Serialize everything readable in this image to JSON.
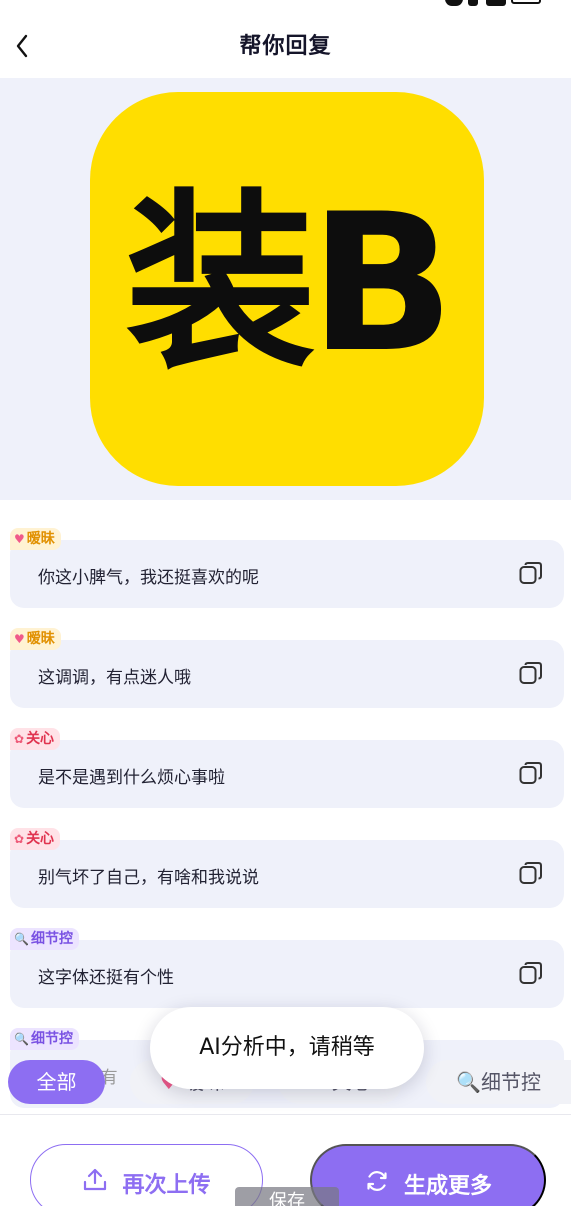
{
  "header": {
    "title": "帮你回复"
  },
  "hero": {
    "logo_text": "装B"
  },
  "replies": [
    {
      "tag_icon": "heart-icon",
      "tag": "暧昧",
      "text": "你这小脾气，我还挺喜欢的呢"
    },
    {
      "tag_icon": "heart-icon",
      "tag": "暧昧",
      "text": "这调调，有点迷人哦"
    },
    {
      "tag_icon": "tulip-icon",
      "tag": "关心",
      "text": "是不是遇到什么烦心事啦"
    },
    {
      "tag_icon": "tulip-icon",
      "tag": "关心",
      "text": "别气坏了自己，有啥和我说说"
    },
    {
      "tag_icon": "magnifier-icon",
      "tag": "细节控",
      "text": "这字体还挺有个性"
    },
    {
      "tag_icon": "magnifier-icon",
      "tag": "细节控",
      "text": "这B字很有"
    }
  ],
  "filters": [
    {
      "label": "全部",
      "active": true
    },
    {
      "label": "暧昧",
      "active": false
    },
    {
      "label": "关心",
      "active": false
    },
    {
      "label": "🔍细节控",
      "active": false
    }
  ],
  "toast": "AI分析中，请稍等",
  "actions": {
    "reupload": "再次上传",
    "generate_more": "生成更多"
  },
  "tooltip": "保存",
  "colors": {
    "accent": "#8d6ef2",
    "logo_bg": "#ffde00",
    "card_bg": "#eff1fa"
  }
}
